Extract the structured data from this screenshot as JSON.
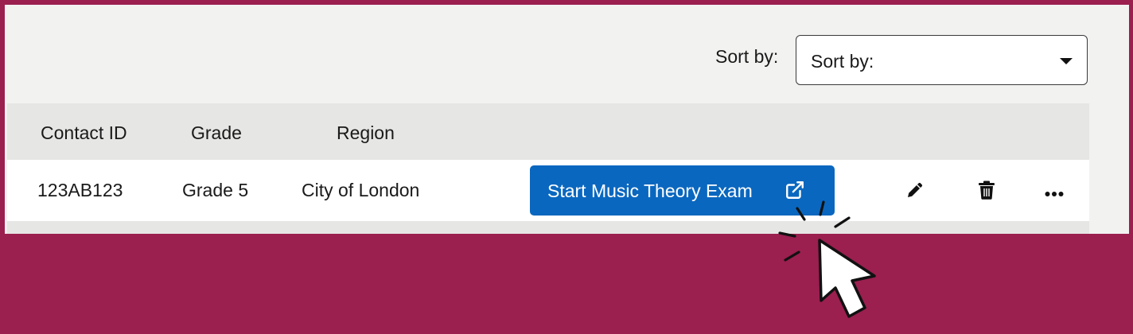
{
  "sort": {
    "label": "Sort by:",
    "select_value": "Sort by:"
  },
  "table": {
    "headers": [
      "Contact ID",
      "Grade",
      "Region"
    ],
    "rows": [
      {
        "contact_id": "123AB123",
        "grade": "Grade 5",
        "region": "City of London",
        "action_label": "Start Music Theory Exam"
      }
    ]
  },
  "icons": {
    "external_link": "external-link-icon",
    "edit": "pencil-icon",
    "delete": "trash-icon",
    "more": "ellipsis-icon",
    "cursor": "mouse-pointer-icon"
  },
  "colors": {
    "background": "#9b1f4f",
    "panel": "#f2f2f1",
    "header_row": "#e6e6e4",
    "primary_button": "#0a67bf"
  }
}
